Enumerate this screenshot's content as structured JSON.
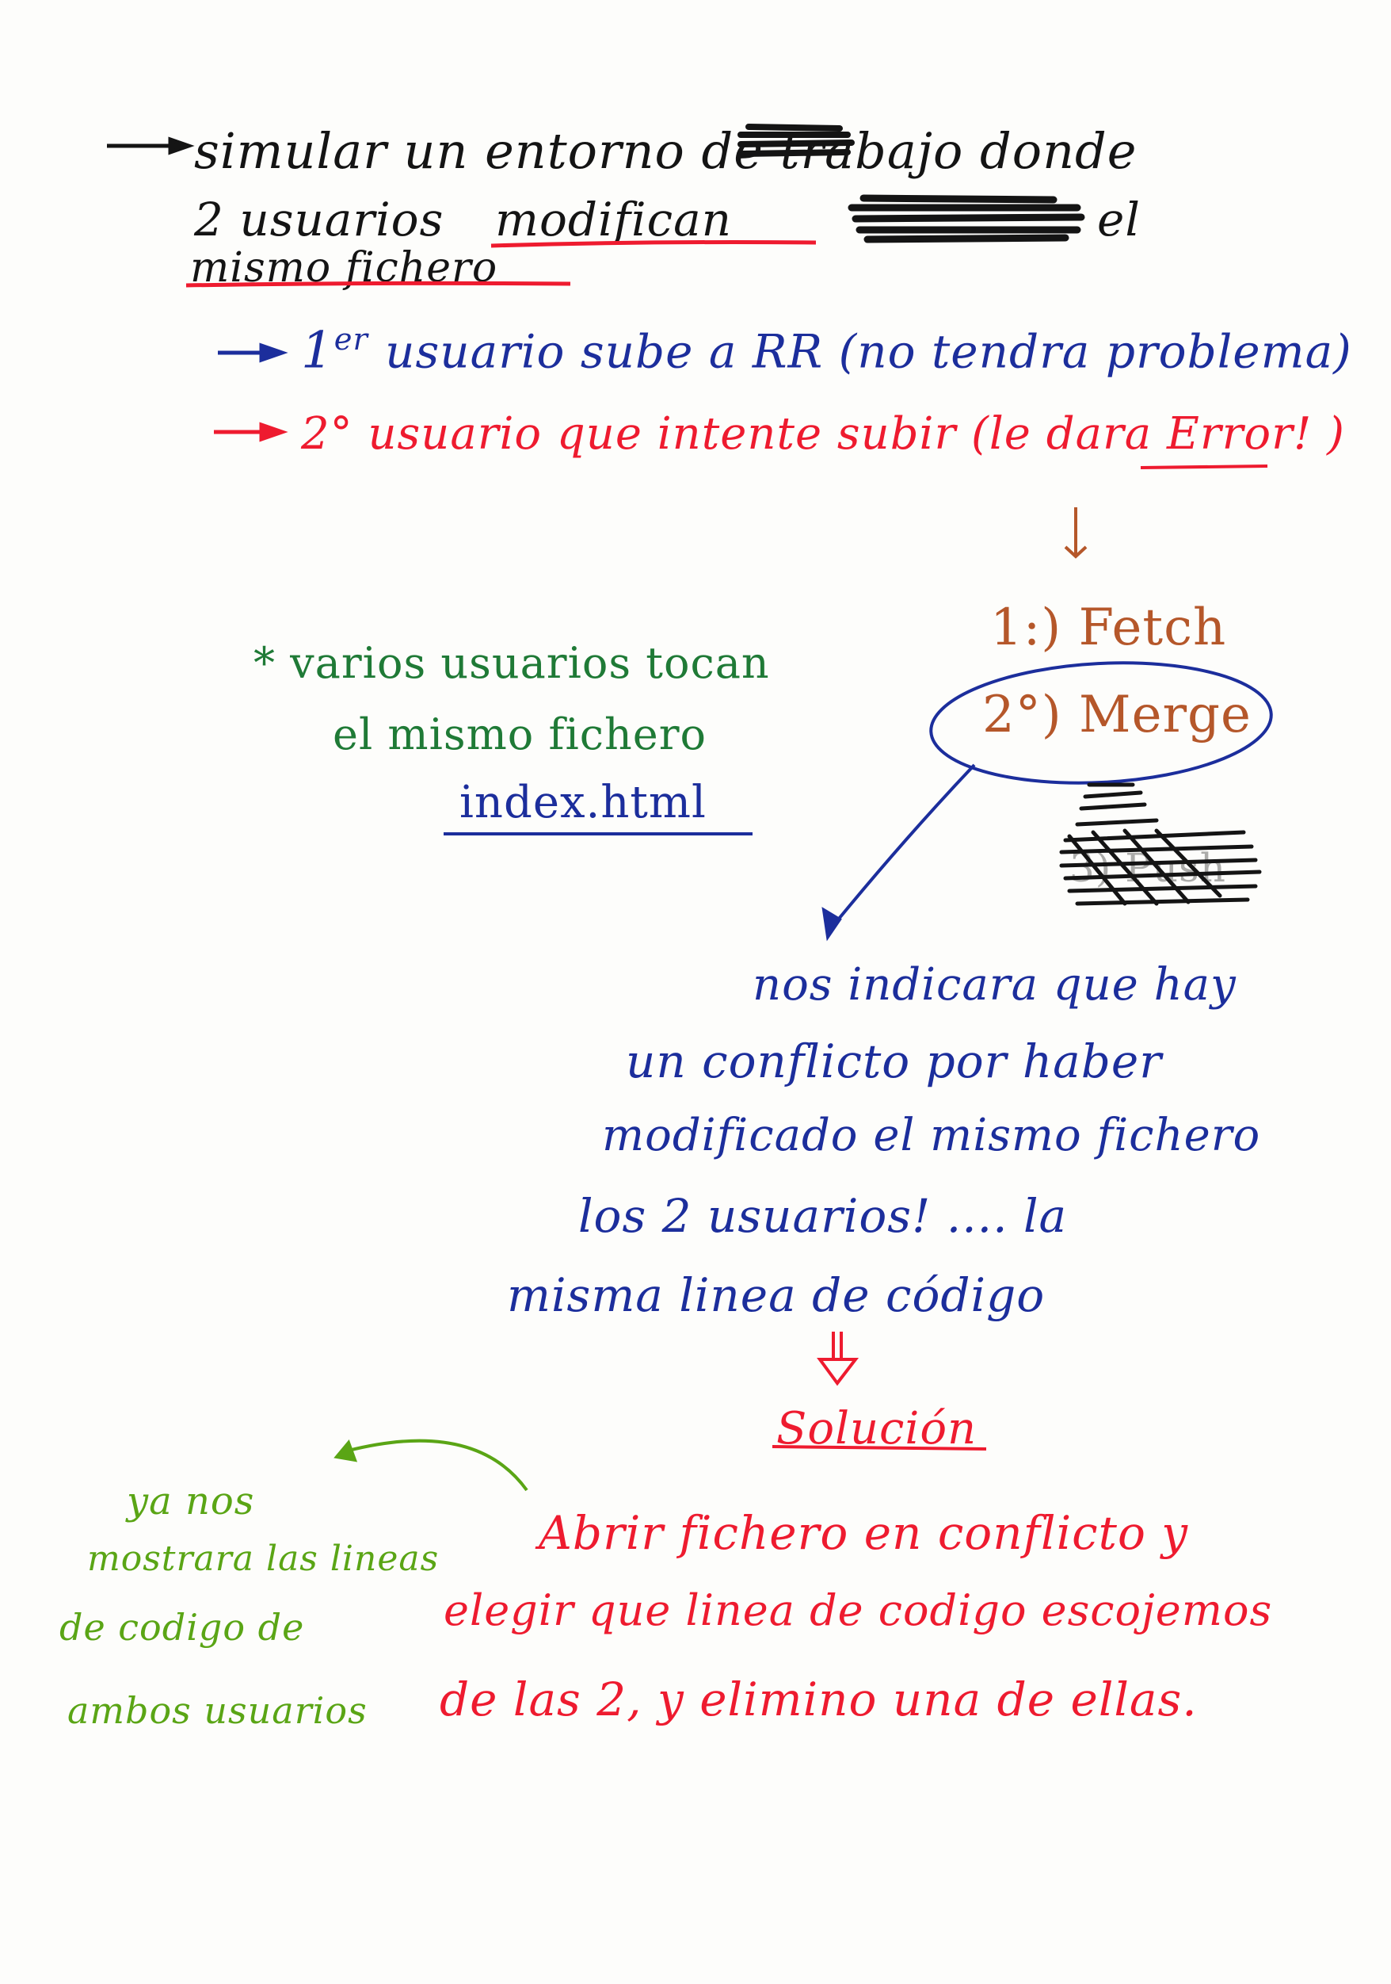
{
  "notes": {
    "line1": "simular un entorno de trabajo donde",
    "line2_start": "2 usuarios",
    "line2_word": "modifican",
    "line2_end": "el",
    "line3": "mismo fichero",
    "step1_prefix": "1",
    "step1_sup": "er",
    "step1_text": "usuario sube a RR (no tendra problema)",
    "step2_prefix": "2°",
    "step2_text": "usuario que intente subir (le dara",
    "step2_error": "Error",
    "step2_end": "! )",
    "fetch": "1:) Fetch",
    "merge": "2°) Merge",
    "push": "3) Push",
    "side_note_1": "* varios usuarios tocan",
    "side_note_2": "el mismo fichero",
    "side_note_3": "index.html",
    "conflict_1": "nos indicara que hay",
    "conflict_2": "un conflicto por haber",
    "conflict_3": "modificado el mismo fichero",
    "conflict_4": "los 2 usuarios! .... la",
    "conflict_5": "misma linea de código",
    "solution_title": "Solución",
    "solution_1": "Abrir fichero en conflicto y",
    "solution_2": "elegir que linea de codigo escojemos",
    "solution_3": "de las 2, y elimino una de ellas.",
    "green_note_1": "ya nos",
    "green_note_2": "mostrara las lineas",
    "green_note_3": "de codigo de",
    "green_note_4": "ambos usuarios"
  },
  "colors": {
    "black": "#141414",
    "blue": "#1c2e9c",
    "red": "#ee1b2f",
    "brown": "#b5572a",
    "green": "#1f7a36",
    "lime": "#5aa515",
    "paper": "#fdfdfb"
  },
  "icons": [
    "arrow-right-icon",
    "arrow-down-icon",
    "hollow-arrow-down-icon",
    "curved-arrow-icon"
  ]
}
